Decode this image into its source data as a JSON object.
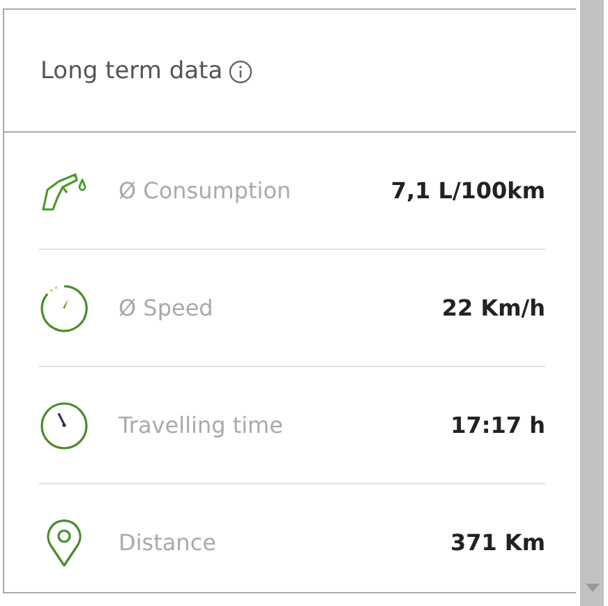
{
  "section": {
    "title": "Long term data"
  },
  "rows": [
    {
      "label": "Ø Consumption",
      "value": "7,1 L/100km"
    },
    {
      "label": "Ø Speed",
      "value": "22 Km/h"
    },
    {
      "label": "Travelling time",
      "value": "17:17 h"
    },
    {
      "label": "Distance",
      "value": "371 Km"
    }
  ]
}
